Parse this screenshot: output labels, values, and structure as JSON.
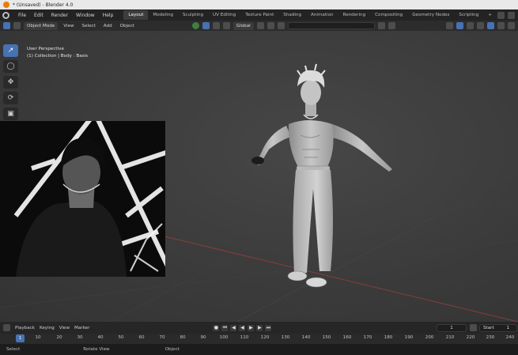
{
  "window": {
    "title": "* (Unsaved) - Blender 4.0"
  },
  "menu": [
    "File",
    "Edit",
    "Render",
    "Window",
    "Help"
  ],
  "workspaces": [
    "Layout",
    "Modeling",
    "Sculpting",
    "UV Editing",
    "Texture Paint",
    "Shading",
    "Animation",
    "Rendering",
    "Compositing",
    "Geometry Nodes",
    "Scripting",
    "+"
  ],
  "header": {
    "mode": "Object Mode",
    "menus": [
      "View",
      "Select",
      "Add",
      "Object"
    ],
    "transform_orientation": "Global"
  },
  "viewport": {
    "perspective": "User Perspective",
    "collection_info": "(1) Collection | Body : Basis"
  },
  "timeline": {
    "menus": [
      "Playback",
      "Keying",
      "View",
      "Marker"
    ],
    "current_frame": "1",
    "start_label": "Start",
    "start_value": "1",
    "ticks": [
      "1",
      "10",
      "20",
      "30",
      "40",
      "50",
      "60",
      "70",
      "80",
      "90",
      "100",
      "110",
      "120",
      "130",
      "140",
      "150",
      "160",
      "170",
      "180",
      "190",
      "200",
      "210",
      "220",
      "230",
      "240"
    ]
  },
  "status": {
    "select": "Select",
    "rotate": "Rotate View",
    "object": "Object"
  },
  "colors": {
    "accent": "#4772b3",
    "grid_x_axis": "#8a3c3c",
    "blender_orange": "#e87d0d"
  }
}
